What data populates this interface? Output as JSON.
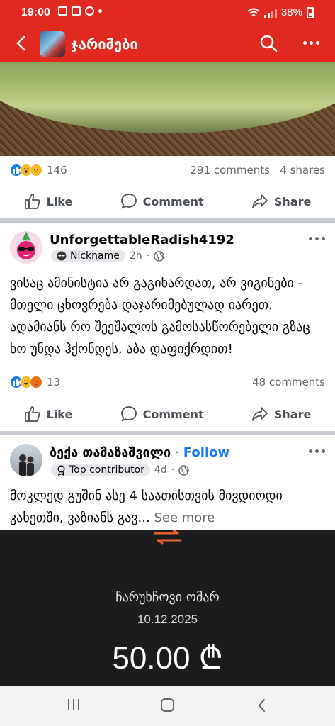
{
  "status_bar": {
    "time": "19:00",
    "battery": "38%"
  },
  "header": {
    "title": "ჯარიმები"
  },
  "post1_footer": {
    "reaction_count": "146",
    "comments": "291 comments",
    "shares": "4 shares"
  },
  "actions": {
    "like": "Like",
    "comment": "Comment",
    "share": "Share"
  },
  "post2": {
    "author": "UnforgettableRadish4192",
    "badge": "Nickname",
    "time": "2h",
    "text": "ვისაც ამინისტია არ გაგიხარდათ, არ ვიგინები - მთელი ცხოვრება დაჯარიმებულად იარეთ. ადამიანს რო შეეშალოს გამოსასწორებელი გზაც ხო უნდა ჰქონდეს, აბა დაფიქრდით!",
    "reaction_count": "13",
    "comments": "48 comments"
  },
  "post3": {
    "author": "ბექა თამაზაშვილი",
    "follow": "Follow",
    "badge": "Top contributor",
    "time": "4d",
    "text": "მოკლედ გუშინ ასე 4 საათისთვის მივდიოდი  კახეთში, ვაზიანს გავ...",
    "see_more": "See more"
  },
  "receipt": {
    "name": "ჩარუხჩოვი ომარ",
    "date": "10.12.2025",
    "amount": "50.00 ₾"
  },
  "icons": {
    "back": "chevron-left-icon",
    "search": "search-icon",
    "more": "more-dots-icon",
    "like": "thumbs-up-icon",
    "comment": "comment-bubble-icon",
    "share": "share-arrow-icon",
    "globe": "globe-icon"
  },
  "colors": {
    "header_red": "#e02a20",
    "facebook_blue": "#1877f2",
    "receipt_bg": "#1c1c1e"
  }
}
